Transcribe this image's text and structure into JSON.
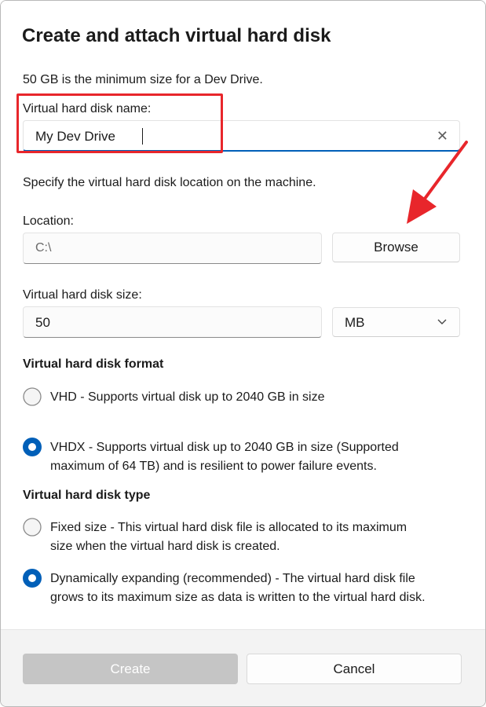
{
  "dialog": {
    "title": "Create and attach virtual hard disk",
    "min_size_note": "50 GB is the minimum size for a Dev Drive.",
    "name_label": "Virtual hard disk name:",
    "name_value": "My Dev Drive",
    "clear_icon": "close-icon",
    "location_note": "Specify the virtual hard disk location on the machine.",
    "location_label": "Location:",
    "location_value": "C:\\",
    "browse_label": "Browse",
    "size_label": "Virtual hard disk size:",
    "size_value": "50",
    "size_unit": "MB",
    "format_heading": "Virtual hard disk format",
    "format_options": [
      {
        "line1": "VHD - Supports virtual disk up to 2040 GB in size",
        "line2": "",
        "selected": false
      },
      {
        "line1": "VHDX - Supports virtual disk up to 2040 GB in size (Supported",
        "line2": "maximum of 64 TB) and is resilient to power failure events.",
        "selected": true
      }
    ],
    "type_heading": "Virtual hard disk type",
    "type_options": [
      {
        "line1": "Fixed size - This virtual hard disk file is allocated to its maximum",
        "line2": "size when the virtual hard disk is created.",
        "selected": false
      },
      {
        "line1": "Dynamically expanding (recommended) - The virtual hard disk file",
        "line2": "grows to its maximum size as data is written to the virtual hard disk.",
        "selected": true
      }
    ],
    "create_label": "Create",
    "cancel_label": "Cancel"
  },
  "colors": {
    "accent": "#005fb8",
    "annotation": "#e8262b",
    "disabled_button": "#c5c5c5"
  }
}
